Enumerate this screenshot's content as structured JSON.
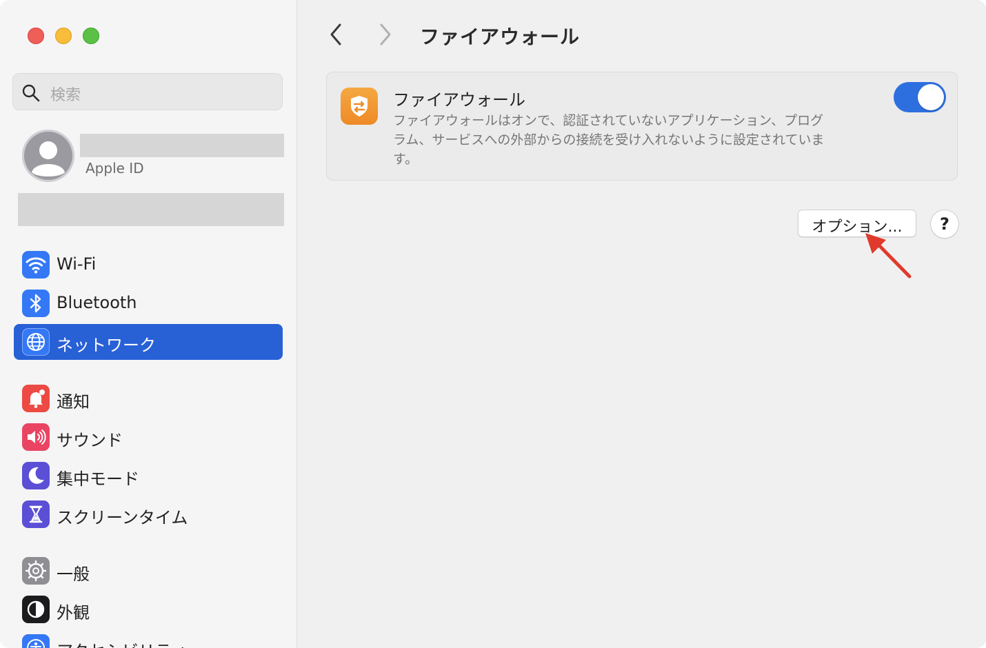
{
  "window": {
    "controls": [
      "close",
      "minimize",
      "maximize"
    ]
  },
  "sidebar": {
    "search": {
      "placeholder": "検索",
      "icon": "search-icon"
    },
    "account": {
      "subtitle": "Apple ID",
      "icon": "person-avatar-icon"
    },
    "items": [
      {
        "label": "Wi-Fi",
        "icon": "wifi-icon",
        "color": "#3478f6",
        "selected": false
      },
      {
        "label": "Bluetooth",
        "icon": "bluetooth-icon",
        "color": "#3478f6",
        "selected": false
      },
      {
        "label": "ネットワーク",
        "icon": "globe-icon",
        "color": "#3478f6",
        "selected": true
      },
      {
        "label": "通知",
        "icon": "bell-icon",
        "color": "#ec4a42",
        "selected": false
      },
      {
        "label": "サウンド",
        "icon": "speaker-icon",
        "color": "#ea4463",
        "selected": false
      },
      {
        "label": "集中モード",
        "icon": "moon-icon",
        "color": "#5b4fd6",
        "selected": false
      },
      {
        "label": "スクリーンタイム",
        "icon": "hourglass-icon",
        "color": "#5b4fd6",
        "selected": false
      },
      {
        "label": "一般",
        "icon": "gear-icon",
        "color": "#8e8e93",
        "selected": false
      },
      {
        "label": "外観",
        "icon": "appearance-icon",
        "color": "#1c1c1e",
        "selected": false
      },
      {
        "label": "アクセシビリティ",
        "icon": "accessibility-icon",
        "color": "#3478f6",
        "selected": false
      }
    ],
    "selected_color": "#2860d6"
  },
  "main": {
    "title": "ファイアウォール",
    "back_icon": "chevron-left-icon",
    "forward_icon": "chevron-right-icon",
    "firewall": {
      "icon": "firewall-shield-icon",
      "title": "ファイアウォール",
      "description": "ファイアウォールはオンで、認証されていないアプリケーション、プログラム、サービスへの外部からの接続を受け入れないように設定されています。",
      "enabled": true,
      "toggle_color": "#2e6fe0"
    },
    "options_button": "オプション...",
    "help_button": "?"
  },
  "annotation": {
    "type": "red-arrow",
    "target": "options_button",
    "color": "#e03a2c"
  }
}
